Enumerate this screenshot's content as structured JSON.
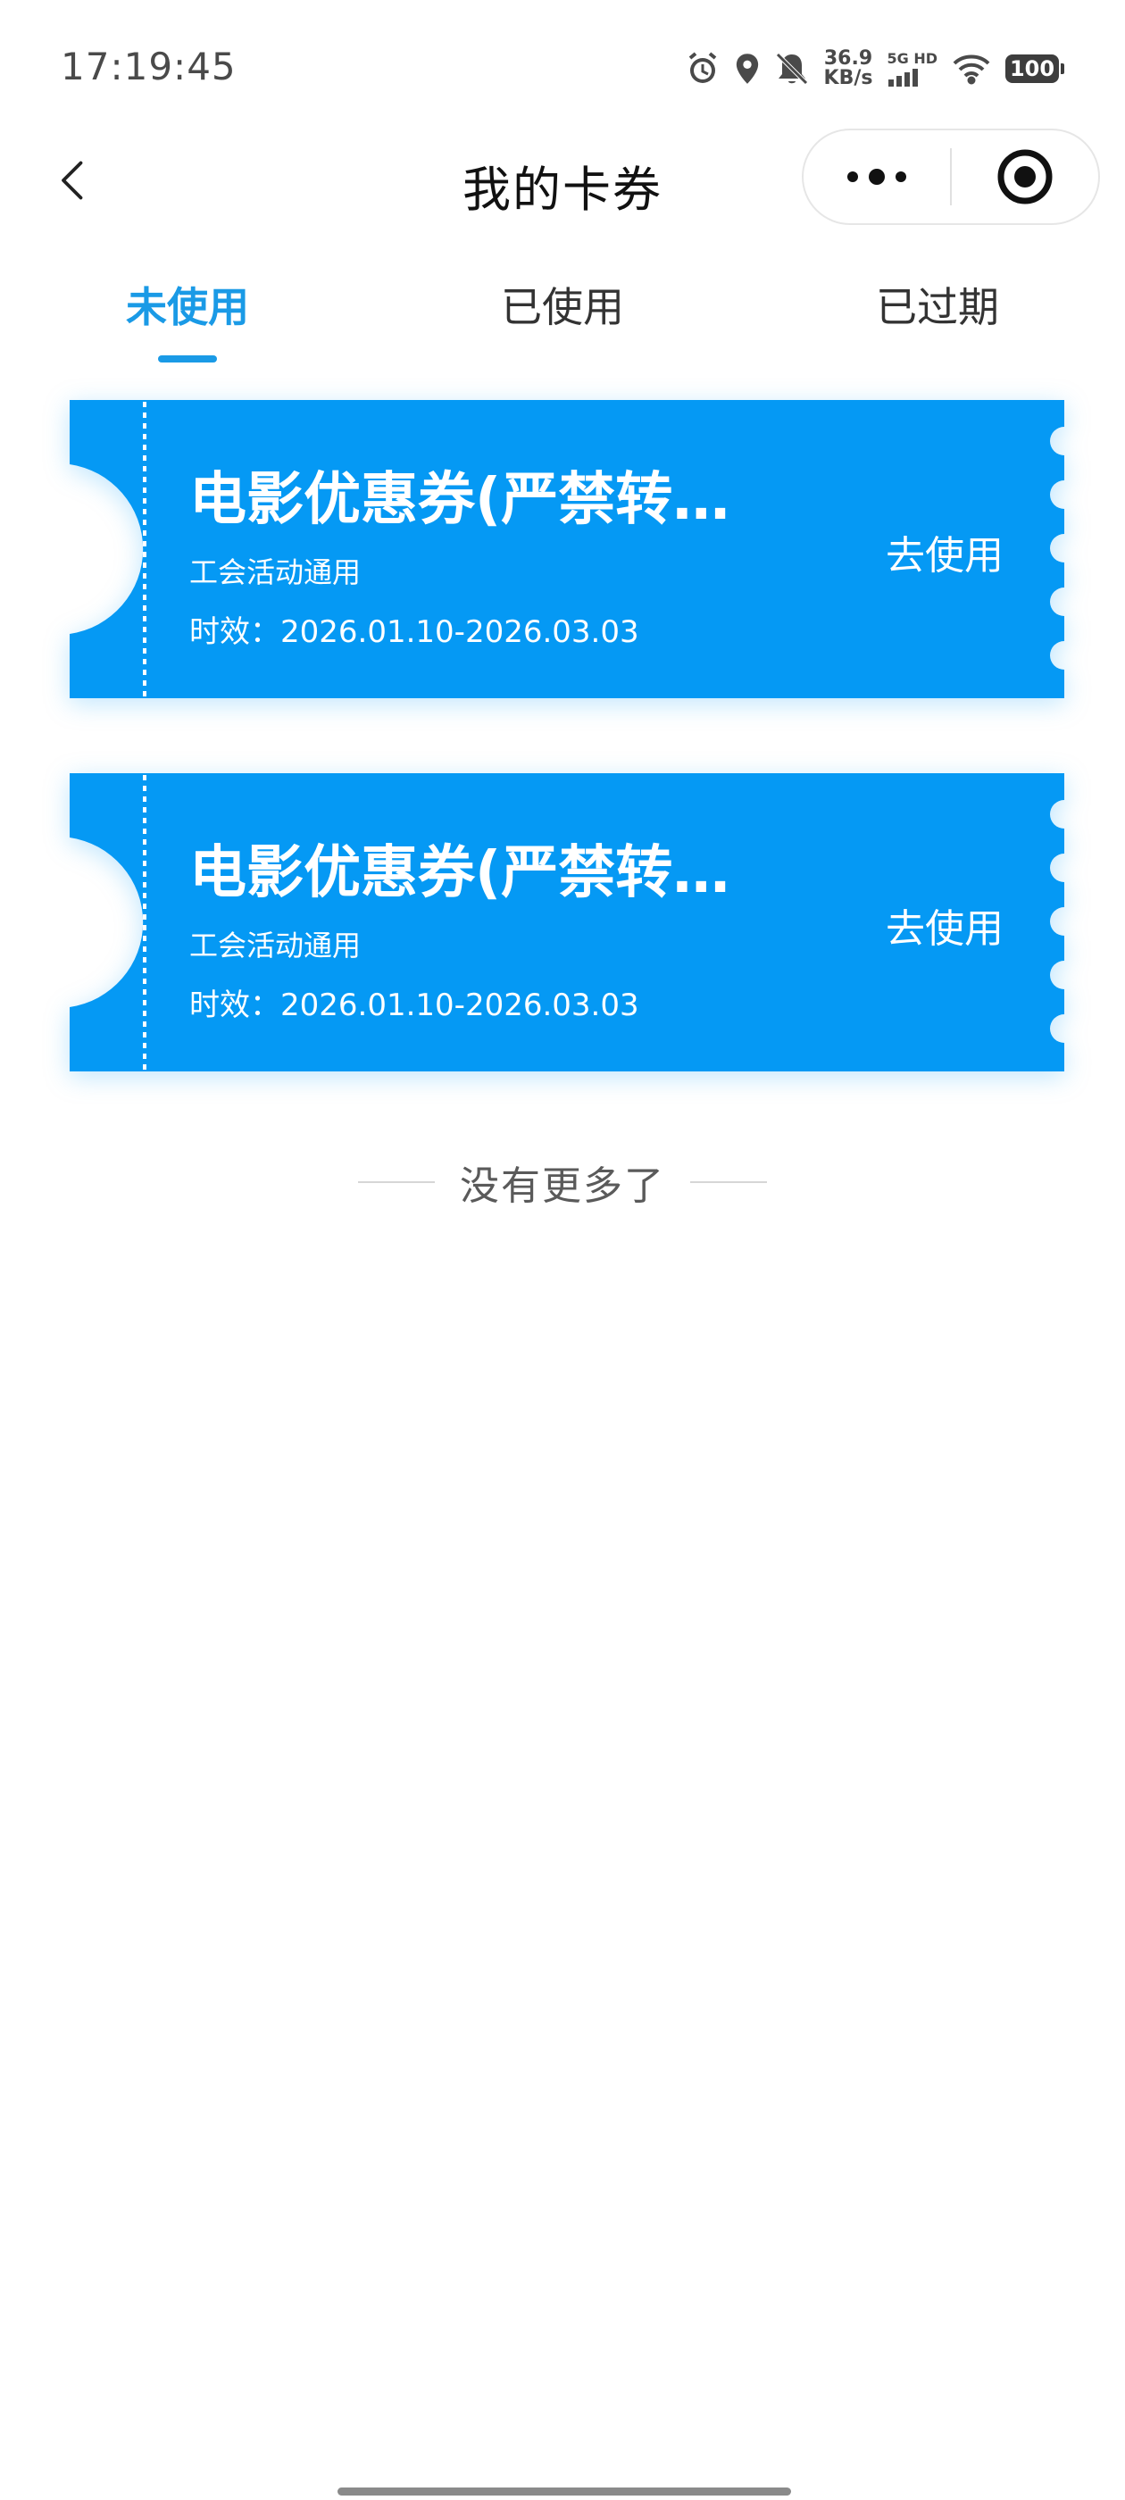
{
  "status_bar": {
    "time": "17:19:45",
    "net_speed_value": "36.9",
    "net_speed_unit": "KB/s",
    "signal_label": "5G HD",
    "battery": "100"
  },
  "nav": {
    "title": "我的卡券"
  },
  "tabs": [
    {
      "label": "未使用",
      "active": true
    },
    {
      "label": "已使用",
      "active": false
    },
    {
      "label": "已过期",
      "active": false
    }
  ],
  "coupons": [
    {
      "title": "电影优惠券(严禁转让…",
      "scope": "工会活动通用",
      "validity": "时效：2026.01.10-2026.03.03",
      "action": "去使用"
    },
    {
      "title": "电影优惠券(严禁转让…",
      "scope": "工会活动通用",
      "validity": "时效：2026.01.10-2026.03.03",
      "action": "去使用"
    }
  ],
  "footer": {
    "no_more": "没有更多了"
  },
  "colors": {
    "accent": "#1a9ae6",
    "coupon_bg": "#0599f4"
  }
}
